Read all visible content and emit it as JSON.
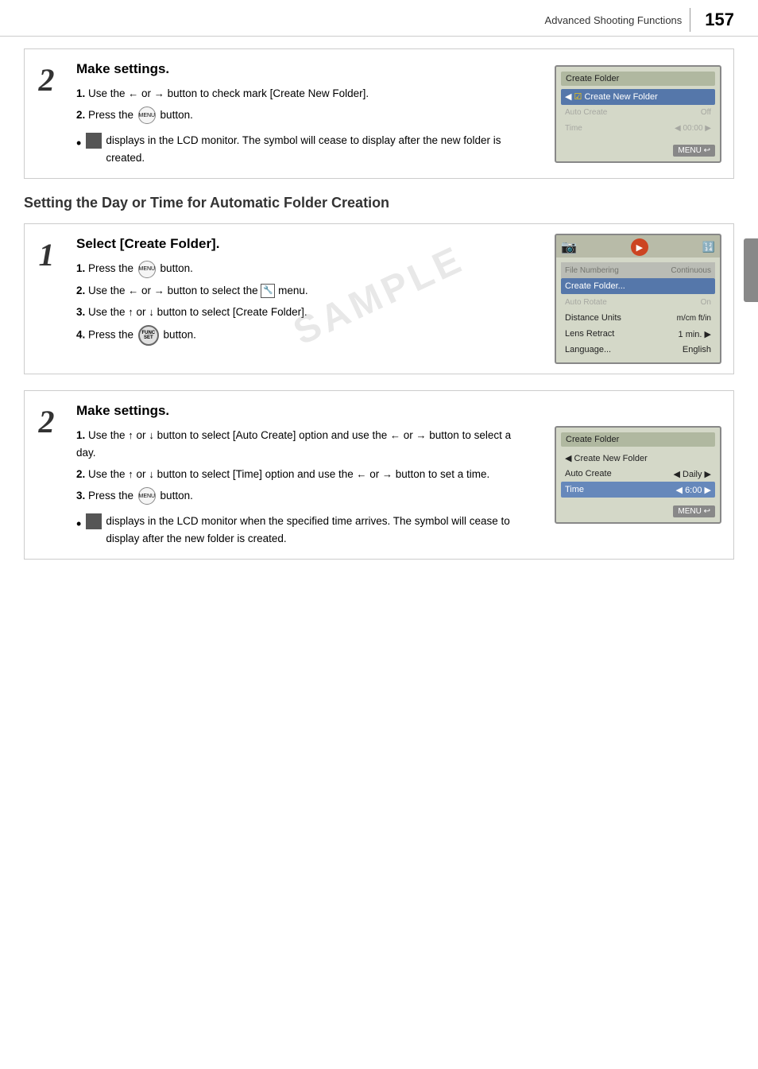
{
  "header": {
    "section_name": "Advanced Shooting Functions",
    "page_number": "157"
  },
  "section1": {
    "step_number": "2",
    "title": "Make settings.",
    "instructions": [
      {
        "num": "1.",
        "text": "Use the ← or → button to check mark [Create New Folder]."
      },
      {
        "num": "2.",
        "text": "Press the MENU button."
      }
    ],
    "note": "displays in the LCD monitor. The symbol will cease to display after the new folder is created.",
    "lcd": {
      "title": "Create Folder",
      "rows": [
        {
          "label": "Create New Folder",
          "value": "",
          "selected": true
        },
        {
          "label": "Auto Create",
          "value": "Off",
          "selected": false,
          "dim": true
        },
        {
          "label": "Time",
          "value": "00:00",
          "selected": false,
          "dim": true
        }
      ],
      "menu_button": "MENU ↩"
    }
  },
  "section2_heading": "Setting the Day or Time for Automatic Folder Creation",
  "section3": {
    "step_number": "1",
    "title": "Select [Create Folder].",
    "instructions": [
      {
        "num": "1.",
        "text": "Press the MENU button."
      },
      {
        "num": "2.",
        "text": "Use the ← or → button to select the wrench menu."
      },
      {
        "num": "3.",
        "text": "Use the ↑ or ↓ button to select [Create Folder]."
      },
      {
        "num": "4.",
        "text": "Press the FUNC/SET button."
      }
    ],
    "lcd": {
      "top_icons": [
        "●",
        "▶",
        "⚙",
        "🔧",
        "🎬",
        "⚡"
      ],
      "rows": [
        {
          "label": "File Numbering",
          "value": "Continuous",
          "dim": true
        },
        {
          "label": "Create Folder...",
          "value": "",
          "selected": true
        },
        {
          "label": "Auto Rotate",
          "value": "On",
          "dim": true
        },
        {
          "label": "Distance Units",
          "value": "m/cm  ft/in",
          "dim": false
        },
        {
          "label": "Lens Retract",
          "value": "1 min.",
          "dim": false
        },
        {
          "label": "Language...",
          "value": "English",
          "dim": false
        }
      ]
    }
  },
  "section4": {
    "step_number": "2",
    "title": "Make settings.",
    "instructions": [
      {
        "num": "1.",
        "text": "Use the ↑ or ↓ button to select [Auto Create] option and use the ← or → button to select a day."
      },
      {
        "num": "2.",
        "text": "Use the ↑ or ↓ button to select [Time] option and use the ← or → button to set a time."
      },
      {
        "num": "3.",
        "text": "Press the MENU button."
      }
    ],
    "note": "displays in the LCD monitor when the specified time arrives. The symbol will cease to display after the new folder is created.",
    "lcd": {
      "title": "Create Folder",
      "rows": [
        {
          "label": "Create New Folder",
          "value": "",
          "selected": false
        },
        {
          "label": "Auto Create",
          "value": "Daily",
          "selected": false,
          "has_arrows": true
        },
        {
          "label": "Time",
          "value": "6:00",
          "selected": false,
          "has_arrows": true
        }
      ],
      "menu_button": "MENU ↩"
    }
  }
}
